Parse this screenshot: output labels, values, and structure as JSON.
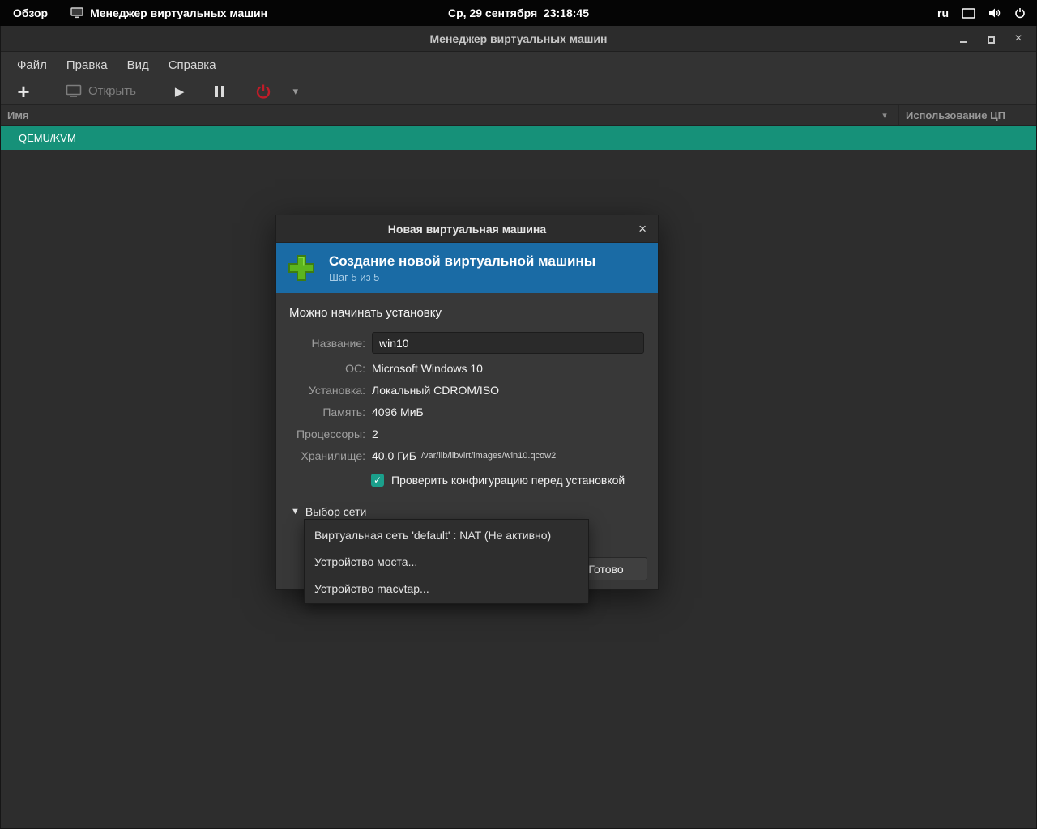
{
  "icons": {
    "close": "×",
    "sort_arrow": "▾",
    "caret_down": "▾",
    "expander_arrow": "▼",
    "check": "✓",
    "plus": "+",
    "play": "▶"
  },
  "topbar": {
    "overview_label": "Обзор",
    "app_indicator": "Менеджер виртуальных машин",
    "clock": "Ср, 29 сентября  23:18:45",
    "keyboard_layout": "ru"
  },
  "window": {
    "title": "Менеджер виртуальных машин",
    "menubar": [
      "Файл",
      "Правка",
      "Вид",
      "Справка"
    ],
    "toolbar": {
      "open_label": "Открыть"
    },
    "list": {
      "name_column": "Имя",
      "cpu_column": "Использование ЦП",
      "rows": [
        {
          "name": "QEMU/KVM"
        }
      ]
    }
  },
  "dialog": {
    "title": "Новая виртуальная машина",
    "header": {
      "title": "Создание новой виртуальной машины",
      "step": "Шаг 5 из 5"
    },
    "ready_text": "Можно начинать установку",
    "fields": [
      {
        "label": "Название:",
        "value": "win10"
      },
      {
        "label": "ОС:",
        "value": "Microsoft Windows 10"
      },
      {
        "label": "Установка:",
        "value": "Локальный CDROM/ISO"
      },
      {
        "label": "Память:",
        "value": "4096 МиБ"
      },
      {
        "label": "Процессоры:",
        "value": "2"
      },
      {
        "label": "Хранилище:",
        "value": "40.0 ГиБ",
        "path": "/var/lib/libvirt/images/win10.qcow2"
      }
    ],
    "checkbox_label": "Проверить конфигурацию перед установкой",
    "network_expander": "Выбор сети",
    "finish_label": "Готово"
  },
  "network_menu": {
    "items": [
      "Виртуальная сеть 'default' : NAT (Не активно)",
      "Устройство моста...",
      "Устройство macvtap..."
    ]
  }
}
